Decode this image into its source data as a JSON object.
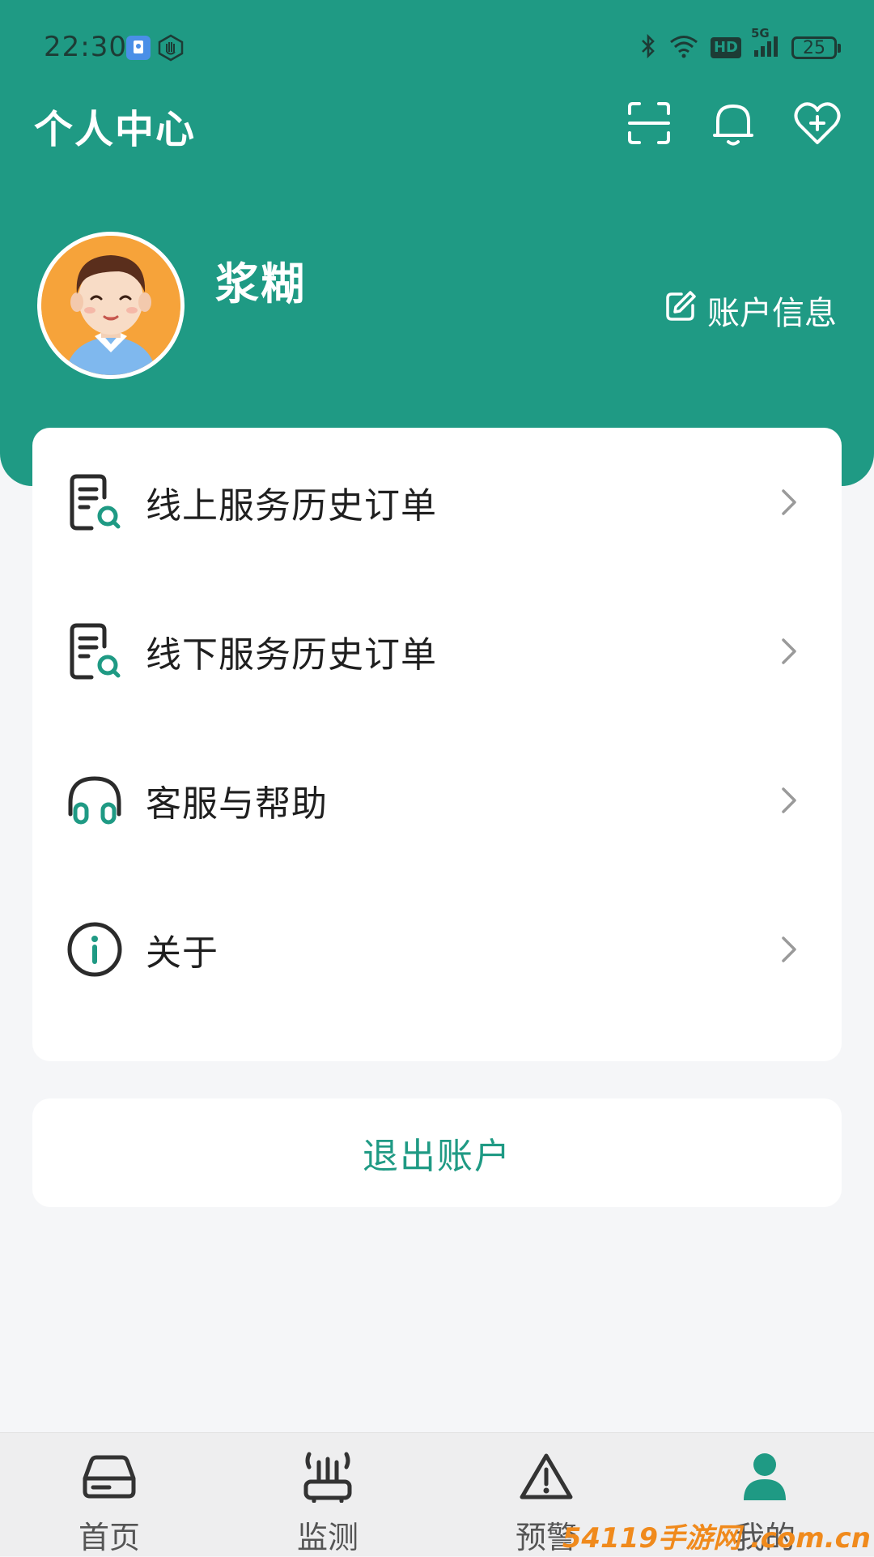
{
  "status_bar": {
    "time": "22:30",
    "network_badge": "HD",
    "network_type": "5G",
    "battery": "25"
  },
  "header": {
    "title": "个人中心",
    "actions": [
      {
        "name": "scan-icon"
      },
      {
        "name": "bell-icon"
      },
      {
        "name": "heart-plus-icon"
      }
    ]
  },
  "profile": {
    "username": "浆糊",
    "account_info_label": "账户信息"
  },
  "menu": {
    "items": [
      {
        "label": "线上服务历史订单",
        "icon": "order-search-icon"
      },
      {
        "label": "线下服务历史订单",
        "icon": "order-search-icon"
      },
      {
        "label": "客服与帮助",
        "icon": "headset-icon"
      },
      {
        "label": "关于",
        "icon": "info-icon"
      }
    ]
  },
  "logout_label": "退出账户",
  "tabbar": {
    "tabs": [
      {
        "label": "首页",
        "icon": "device-icon",
        "active": false
      },
      {
        "label": "监测",
        "icon": "router-icon",
        "active": false
      },
      {
        "label": "预警",
        "icon": "warning-icon",
        "active": false
      },
      {
        "label": "我的",
        "icon": "profile-icon",
        "active": true
      }
    ]
  },
  "colors": {
    "accent": "#1f9a84",
    "background": "#f5f6f8"
  },
  "watermark": "54119手游网 .com.cn"
}
